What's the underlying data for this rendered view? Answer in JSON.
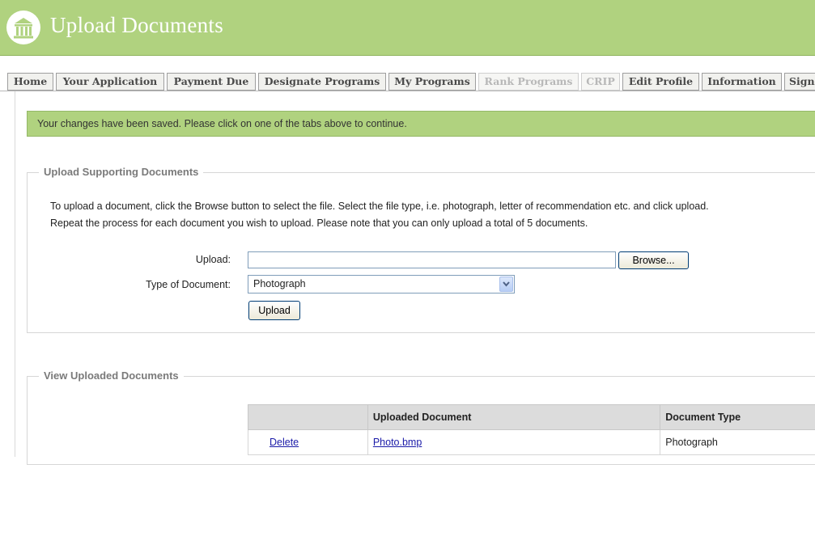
{
  "header": {
    "title": "Upload Documents",
    "logo_icon": "institution-columns-icon",
    "bg_color": "#b0d27f"
  },
  "tabs": [
    {
      "label": "Home",
      "enabled": true
    },
    {
      "label": "Your Application",
      "enabled": true
    },
    {
      "label": "Payment Due",
      "enabled": true
    },
    {
      "label": "Designate Programs",
      "enabled": true
    },
    {
      "label": "My Programs",
      "enabled": true
    },
    {
      "label": "Rank Programs",
      "enabled": false
    },
    {
      "label": "CRIP",
      "enabled": false
    },
    {
      "label": "Edit Profile",
      "enabled": true
    },
    {
      "label": "Information",
      "enabled": true
    },
    {
      "label": "Sign",
      "enabled": true
    }
  ],
  "message": "Your changes have been saved. Please click on one of the tabs above to continue.",
  "upload_section": {
    "legend": "Upload Supporting Documents",
    "instructions_line1": "To upload a document, click the Browse button to select the file. Select the file type, i.e. photograph, letter of recommendation etc. and click upload.",
    "instructions_line2": "Repeat the process for each document you wish to upload. Please note that you can only upload a total of 5 documents.",
    "upload_label": "Upload:",
    "file_value": "",
    "browse_label": "Browse...",
    "type_label": "Type of Document:",
    "type_selected": "Photograph",
    "upload_button": "Upload"
  },
  "view_section": {
    "legend": "View Uploaded Documents",
    "columns": [
      "",
      "Uploaded Document",
      "Document Type"
    ],
    "rows": [
      {
        "action": "Delete",
        "document": "Photo.bmp",
        "type": "Photograph"
      }
    ]
  }
}
